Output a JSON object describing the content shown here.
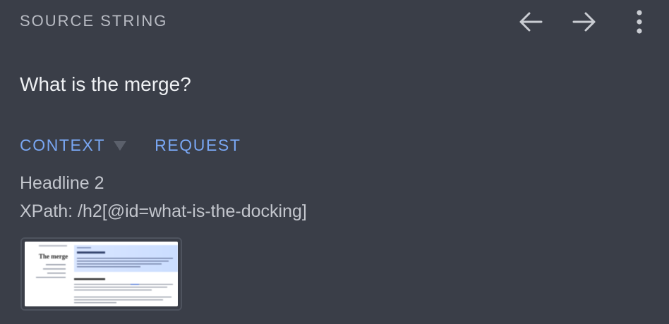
{
  "header": {
    "title": "SOURCE STRING",
    "back_icon": "arrow-left-icon",
    "forward_icon": "arrow-right-icon",
    "more_icon": "more-vert-icon"
  },
  "source": {
    "text": "What is the merge?"
  },
  "tabs": [
    {
      "label": "CONTEXT",
      "active": true
    },
    {
      "label": "REQUEST",
      "active": false
    }
  ],
  "context": {
    "type": "Headline 2",
    "xpath": "XPath: /h2[@id=what-is-the-docking]"
  },
  "screenshot": {
    "page_heading": "The merge",
    "page_subheading": "What is the merge?",
    "banner_heading": "-- ⚙ ⚙ ⚙ --"
  },
  "colors": {
    "background": "#3a3e48",
    "accent": "#79a6f2",
    "title": "#b9bcc4",
    "text": "#eef0f3",
    "muted": "#c3c6cd"
  }
}
